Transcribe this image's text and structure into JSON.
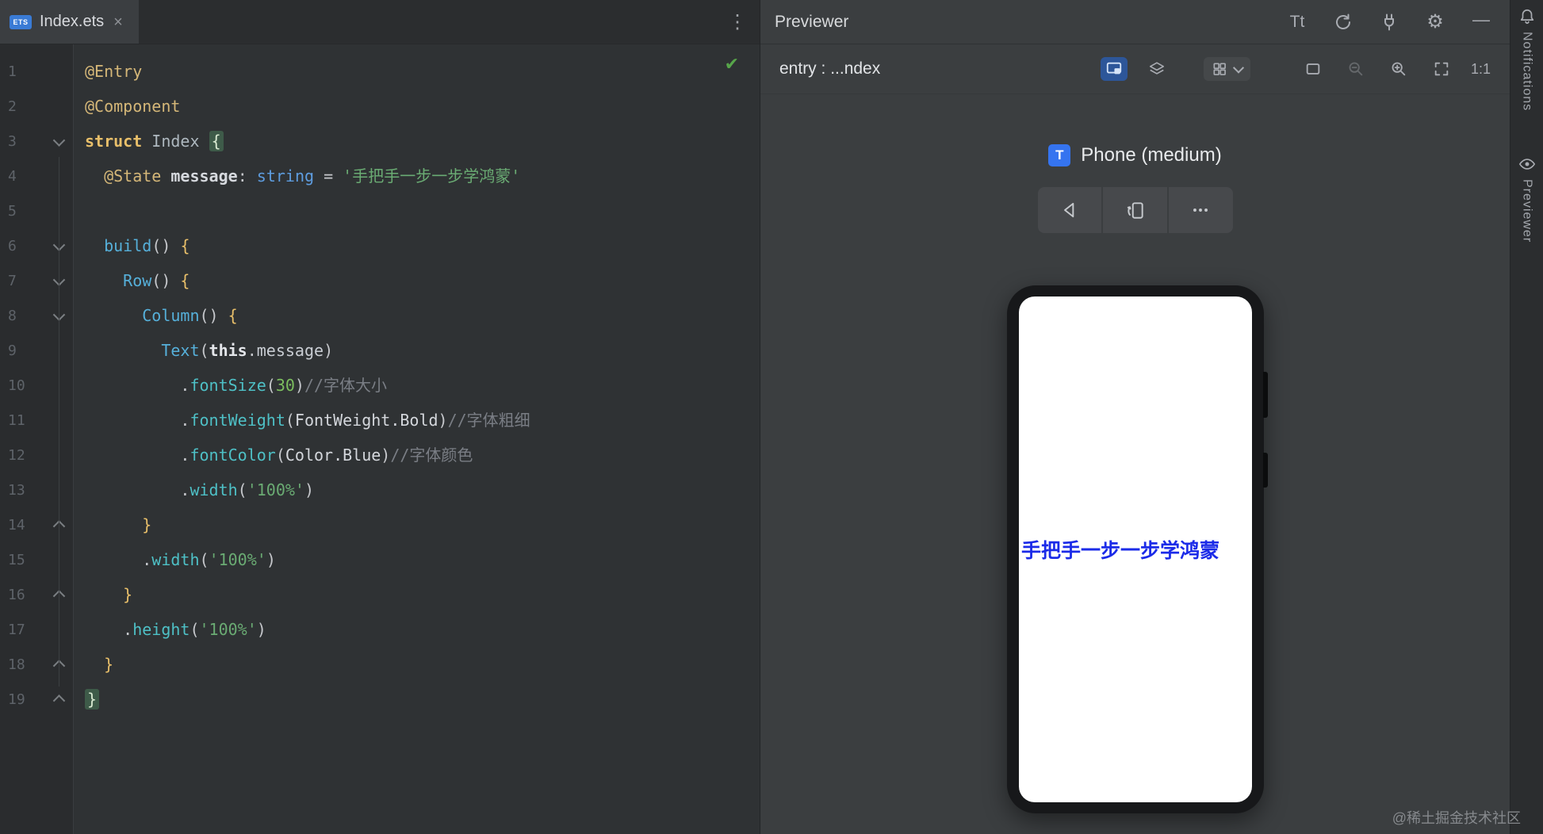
{
  "editor": {
    "tab": {
      "label": "Index.ets",
      "icon_text": "ETS",
      "close": "×"
    },
    "overflow_menu": "⋮",
    "inspection_check": "✔",
    "lines": [
      {
        "n": 1,
        "fold": "",
        "tokens": [
          [
            "dec",
            "@Entry"
          ]
        ]
      },
      {
        "n": 2,
        "fold": "",
        "tokens": [
          [
            "dec",
            "@Component"
          ]
        ]
      },
      {
        "n": 3,
        "fold": "down",
        "tokens": [
          [
            "kwd",
            "struct"
          ],
          [
            "pun",
            " "
          ],
          [
            "typ",
            "Index"
          ],
          [
            "pun",
            " "
          ],
          [
            "brcHl",
            "{"
          ]
        ]
      },
      {
        "n": 4,
        "fold": "",
        "tokens": [
          [
            "pun",
            "  "
          ],
          [
            "dec",
            "@State"
          ],
          [
            "pun",
            " "
          ],
          [
            "propb",
            "message"
          ],
          [
            "pun",
            ": "
          ],
          [
            "typ2",
            "string"
          ],
          [
            "pun",
            " = "
          ],
          [
            "str",
            "'手把手一步一步学鸿蒙'"
          ]
        ]
      },
      {
        "n": 5,
        "fold": "",
        "tokens": []
      },
      {
        "n": 6,
        "fold": "down",
        "tokens": [
          [
            "pun",
            "  "
          ],
          [
            "fn",
            "build"
          ],
          [
            "pun",
            "() "
          ],
          [
            "brc",
            "{"
          ]
        ]
      },
      {
        "n": 7,
        "fold": "down",
        "tokens": [
          [
            "pun",
            "    "
          ],
          [
            "fn",
            "Row"
          ],
          [
            "pun",
            "() "
          ],
          [
            "brc",
            "{"
          ]
        ]
      },
      {
        "n": 8,
        "fold": "down",
        "tokens": [
          [
            "pun",
            "      "
          ],
          [
            "fn",
            "Column"
          ],
          [
            "pun",
            "() "
          ],
          [
            "brc",
            "{"
          ]
        ]
      },
      {
        "n": 9,
        "fold": "",
        "tokens": [
          [
            "pun",
            "        "
          ],
          [
            "fn",
            "Text"
          ],
          [
            "pun",
            "("
          ],
          [
            "self",
            "this"
          ],
          [
            "pun",
            "."
          ],
          [
            "prop",
            "message"
          ],
          [
            "pun",
            ")"
          ]
        ]
      },
      {
        "n": 10,
        "fold": "",
        "tokens": [
          [
            "pun",
            "          ."
          ],
          [
            "meth",
            "fontSize"
          ],
          [
            "pun",
            "("
          ],
          [
            "num",
            "30"
          ],
          [
            "pun",
            ")"
          ],
          [
            "cmt",
            "//字体大小"
          ]
        ]
      },
      {
        "n": 11,
        "fold": "",
        "tokens": [
          [
            "pun",
            "          ."
          ],
          [
            "meth",
            "fontWeight"
          ],
          [
            "pun",
            "("
          ],
          [
            "idn",
            "FontWeight.Bold"
          ],
          [
            "pun",
            ")"
          ],
          [
            "cmt",
            "//字体粗细"
          ]
        ]
      },
      {
        "n": 12,
        "fold": "",
        "tokens": [
          [
            "pun",
            "          ."
          ],
          [
            "meth",
            "fontColor"
          ],
          [
            "pun",
            "("
          ],
          [
            "idn",
            "Color.Blue"
          ],
          [
            "pun",
            ")"
          ],
          [
            "cmt",
            "//字体颜色"
          ]
        ]
      },
      {
        "n": 13,
        "fold": "",
        "tokens": [
          [
            "pun",
            "          ."
          ],
          [
            "meth",
            "width"
          ],
          [
            "pun",
            "("
          ],
          [
            "str",
            "'100%'"
          ],
          [
            "pun",
            ")"
          ]
        ]
      },
      {
        "n": 14,
        "fold": "up",
        "tokens": [
          [
            "pun",
            "      "
          ],
          [
            "brc",
            "}"
          ]
        ]
      },
      {
        "n": 15,
        "fold": "",
        "tokens": [
          [
            "pun",
            "      ."
          ],
          [
            "meth",
            "width"
          ],
          [
            "pun",
            "("
          ],
          [
            "str",
            "'100%'"
          ],
          [
            "pun",
            ")"
          ]
        ]
      },
      {
        "n": 16,
        "fold": "up",
        "tokens": [
          [
            "pun",
            "    "
          ],
          [
            "brc",
            "}"
          ]
        ]
      },
      {
        "n": 17,
        "fold": "",
        "tokens": [
          [
            "pun",
            "    ."
          ],
          [
            "meth",
            "height"
          ],
          [
            "pun",
            "("
          ],
          [
            "str",
            "'100%'"
          ],
          [
            "pun",
            ")"
          ]
        ]
      },
      {
        "n": 18,
        "fold": "up",
        "tokens": [
          [
            "pun",
            "  "
          ],
          [
            "brc",
            "}"
          ]
        ]
      },
      {
        "n": 19,
        "fold": "up",
        "tokens": [
          [
            "brcHl",
            "}"
          ]
        ]
      }
    ]
  },
  "previewer": {
    "title": "Previewer",
    "toolbar": {
      "font_icon": "Tt",
      "zoom_ratio": "1:1"
    },
    "target": "entry : ...ndex",
    "device": {
      "component_badge": "T",
      "label": "Phone (medium)"
    },
    "phone": {
      "text": "手把手一步一步学鸿蒙",
      "text_color": "#1B2BE8"
    }
  },
  "strip": {
    "notifications": "Notifications",
    "previewer": "Previewer"
  },
  "watermark": "@稀土掘金技术社区",
  "accent_color": "#3574F0"
}
